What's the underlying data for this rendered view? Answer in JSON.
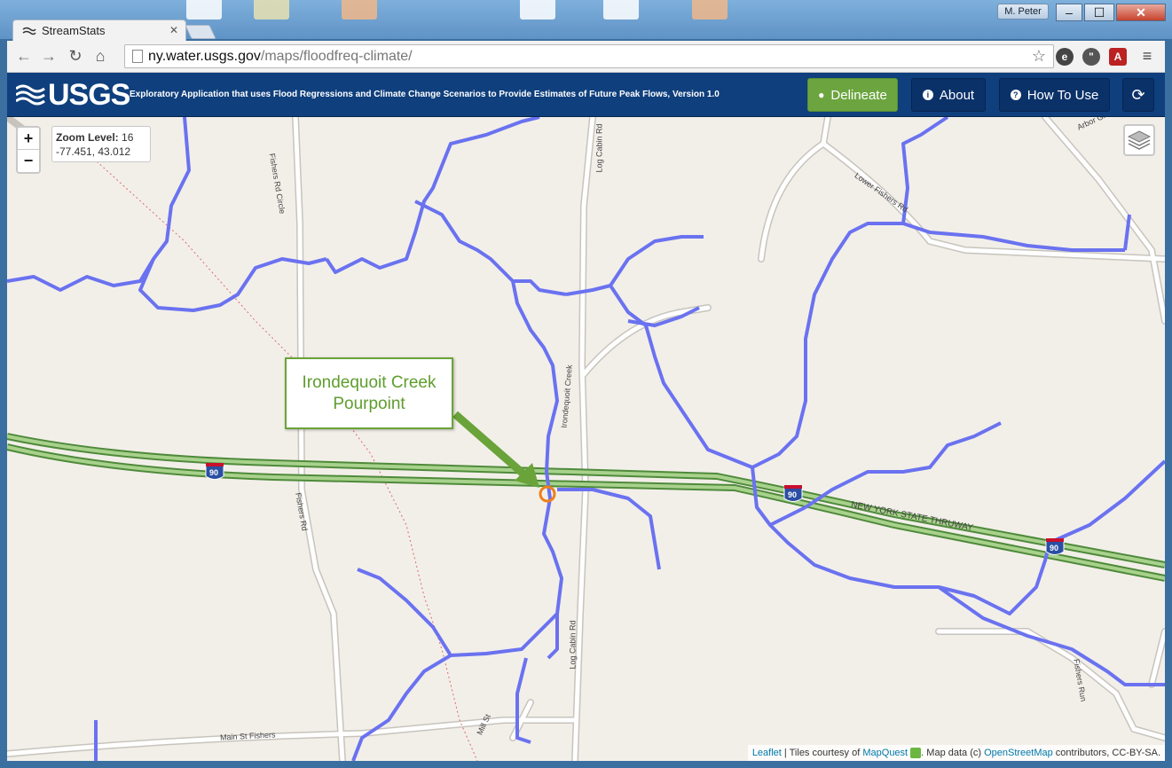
{
  "os": {
    "user_label": "M. Peter"
  },
  "browser": {
    "tab_title": "StreamStats",
    "url_host": "ny.water.usgs.gov",
    "url_path": "/maps/floodfreq-climate/"
  },
  "header": {
    "logo_text": "USGS",
    "title": "Exploratory Application that uses Flood Regressions and Climate Change Scenarios to Provide Estimates of Future Peak Flows, Version 1.0",
    "delineate_label": "Delineate",
    "about_label": "About",
    "howto_label": "How To Use"
  },
  "map": {
    "zoom_in": "+",
    "zoom_out": "−",
    "zoom_label": "Zoom Level:",
    "zoom_value": "16",
    "coords": "-77.451, 43.012",
    "callout_line1": "Irondequoit Creek",
    "callout_line2": "Pourpoint",
    "road_labels": {
      "log_cabin_top": "Log Cabin Rd",
      "log_cabin_bottom": "Log Cabin Rd",
      "fishers_rd_circle": "Fishers Rd Circle",
      "fishers_rd": "Fishers Rd",
      "lower_fishers": "Lower Fishers Rd",
      "arbor": "Arbor Gl",
      "nys_thruway": "NEW YORK STATE THRUWAY",
      "main_st": "Main St Fishers",
      "mill_st": "Mill St",
      "fishers_run": "Fishers Run",
      "creek": "Irondequoit Creek"
    },
    "shields": [
      "90",
      "90",
      "90"
    ],
    "attribution": {
      "leaflet": "Leaflet",
      "tiles": " | Tiles courtesy of ",
      "mapquest": "MapQuest",
      "data": ". Map data (c) ",
      "osm": "OpenStreetMap",
      "license": " contributors, CC-BY-SA."
    }
  },
  "colors": {
    "header": "#0f3f7d",
    "delineate": "#6ca540",
    "stream": "#6a72f0",
    "highway": "#6aa84f",
    "pourpoint": "#f07f1a"
  }
}
